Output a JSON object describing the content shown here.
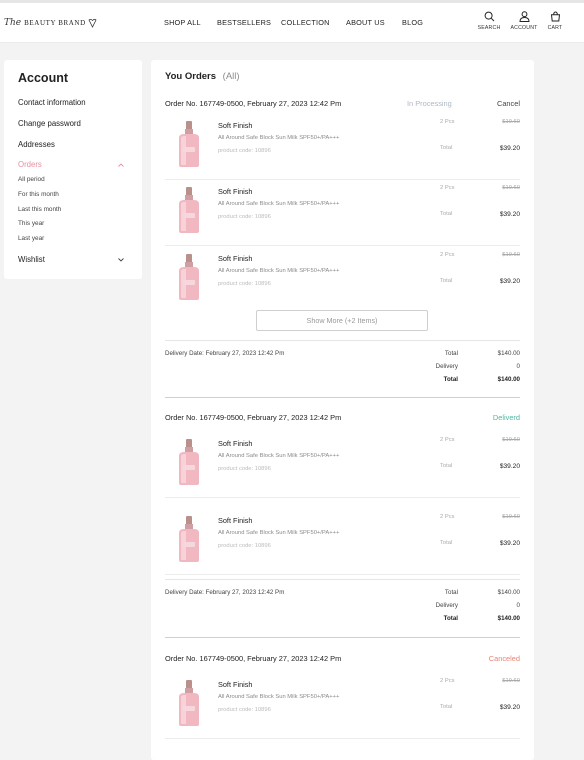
{
  "brand": {
    "script": "The",
    "caps": "BEAUTY BRAND"
  },
  "nav": [
    "SHOP ALL",
    "BESTSELLERS",
    "COLLECTION",
    "ABOUT US",
    "BLOG"
  ],
  "header_icons": [
    {
      "icon": "search-icon",
      "label": "SEARCH"
    },
    {
      "icon": "account-icon",
      "label": "ACCOUNT"
    },
    {
      "icon": "cart-icon",
      "label": "CART"
    }
  ],
  "sidebar": {
    "title": "Account",
    "items": [
      "Contact information",
      "Change password",
      "Addresses"
    ],
    "orders_label": "Orders",
    "order_filters": [
      "All period",
      "For this month",
      "Last this month",
      "This year",
      "Last year"
    ],
    "wishlist_label": "Wishlist"
  },
  "main": {
    "title": "You Orders",
    "title_filter": "(All)",
    "show_more": "Show More (+2 Items)",
    "product": {
      "name": "Soft Finish",
      "desc": "All Around Safe Block Sun Milk SPF50+/PA+++",
      "code": "product code: 10896",
      "qty": "2 Pcs",
      "price": "$19.60",
      "total_label": "Total",
      "total_value": "$39.20"
    },
    "summary_labels": {
      "total": "Total",
      "delivery": "Delivery"
    },
    "orders": [
      {
        "number": "Order No. 167749-0500, February 27, 2023 12:42 Pm",
        "status": "In Processing",
        "action": "Cancel",
        "delivery_date": "Delivery Date: February 27, 2023 12:42 Pm",
        "total": "$140.00",
        "delivery": "0",
        "grand_total": "$140.00"
      },
      {
        "number": "Order No. 167749-0500, February 27, 2023 12:42 Pm",
        "status": "Deliverd",
        "delivery_date": "Delivery Date: February 27, 2023 12:42 Pm",
        "total": "$140.00",
        "delivery": "0",
        "grand_total": "$140.00"
      },
      {
        "number": "Order No. 167749-0500, February 27, 2023 12:42 Pm",
        "status": "Canceled"
      }
    ]
  },
  "colors": {
    "accent_pink": "#e88fa0",
    "status_processing": "#aeb8c4",
    "status_delivered": "#4fb7a1",
    "status_canceled": "#e88474"
  }
}
